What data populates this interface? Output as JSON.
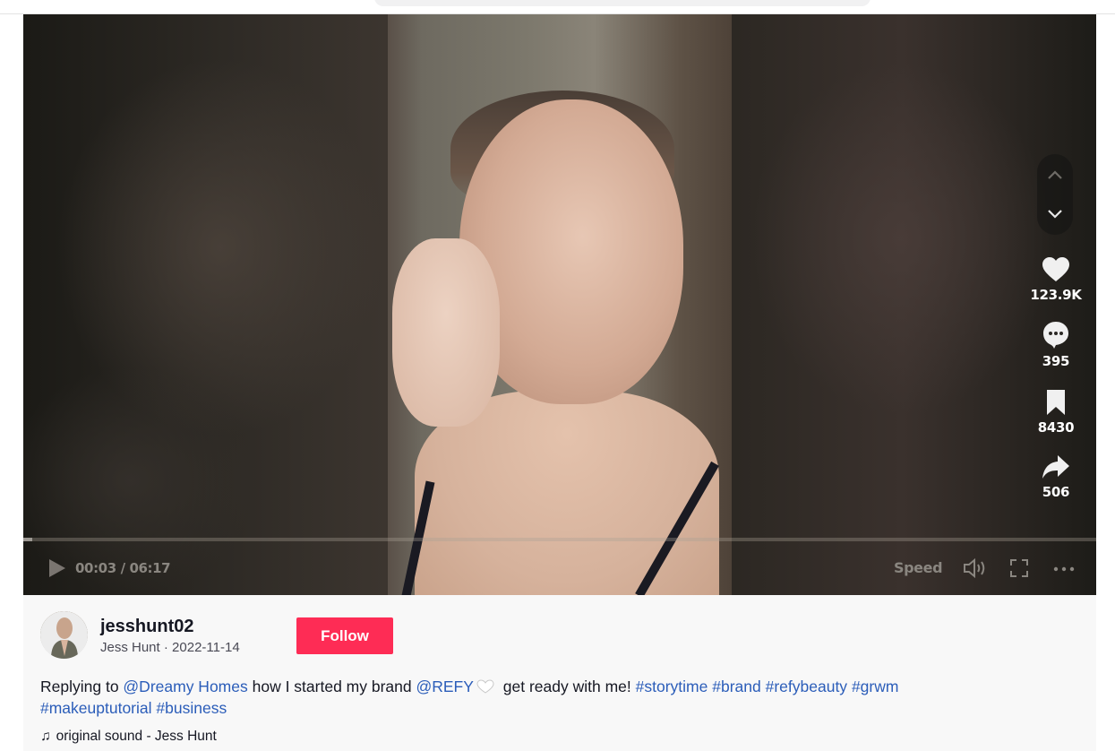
{
  "topbar": {
    "search_placeholder": ""
  },
  "player": {
    "nav": {
      "up_icon": "chevron-up-icon",
      "down_icon": "chevron-down-icon"
    },
    "actions": [
      {
        "name": "like",
        "icon": "heart-icon",
        "count": "123.9K"
      },
      {
        "name": "comment",
        "icon": "comment-icon",
        "count": "395"
      },
      {
        "name": "save",
        "icon": "bookmark-icon",
        "count": "8430"
      },
      {
        "name": "share",
        "icon": "share-icon",
        "count": "506"
      }
    ],
    "progress": {
      "current": "00:03",
      "duration": "06:17",
      "fraction": 0.008
    },
    "time_display": "00:03 / 06:17",
    "speed_label": "Speed",
    "colors": {
      "control_gray": "#8a8680"
    }
  },
  "author": {
    "username": "jesshunt02",
    "display_name": "Jess Hunt",
    "separator": " · ",
    "date": "2022-11-14",
    "follow_label": "Follow",
    "follow_color": "#fe2c55"
  },
  "caption": {
    "prefix": "Replying to ",
    "mention1": "@Dreamy Homes",
    "text1": " how I started my brand ",
    "mention2": "@REFY",
    "text2": " get ready with me! ",
    "hashtags": [
      "#storytime",
      "#brand",
      "#refybeauty",
      "#grwm",
      "#makeuptutorial",
      "#business"
    ],
    "link_color": "#2b5db9"
  },
  "sound": {
    "icon": "music-note-icon",
    "label": "original sound - Jess Hunt"
  }
}
